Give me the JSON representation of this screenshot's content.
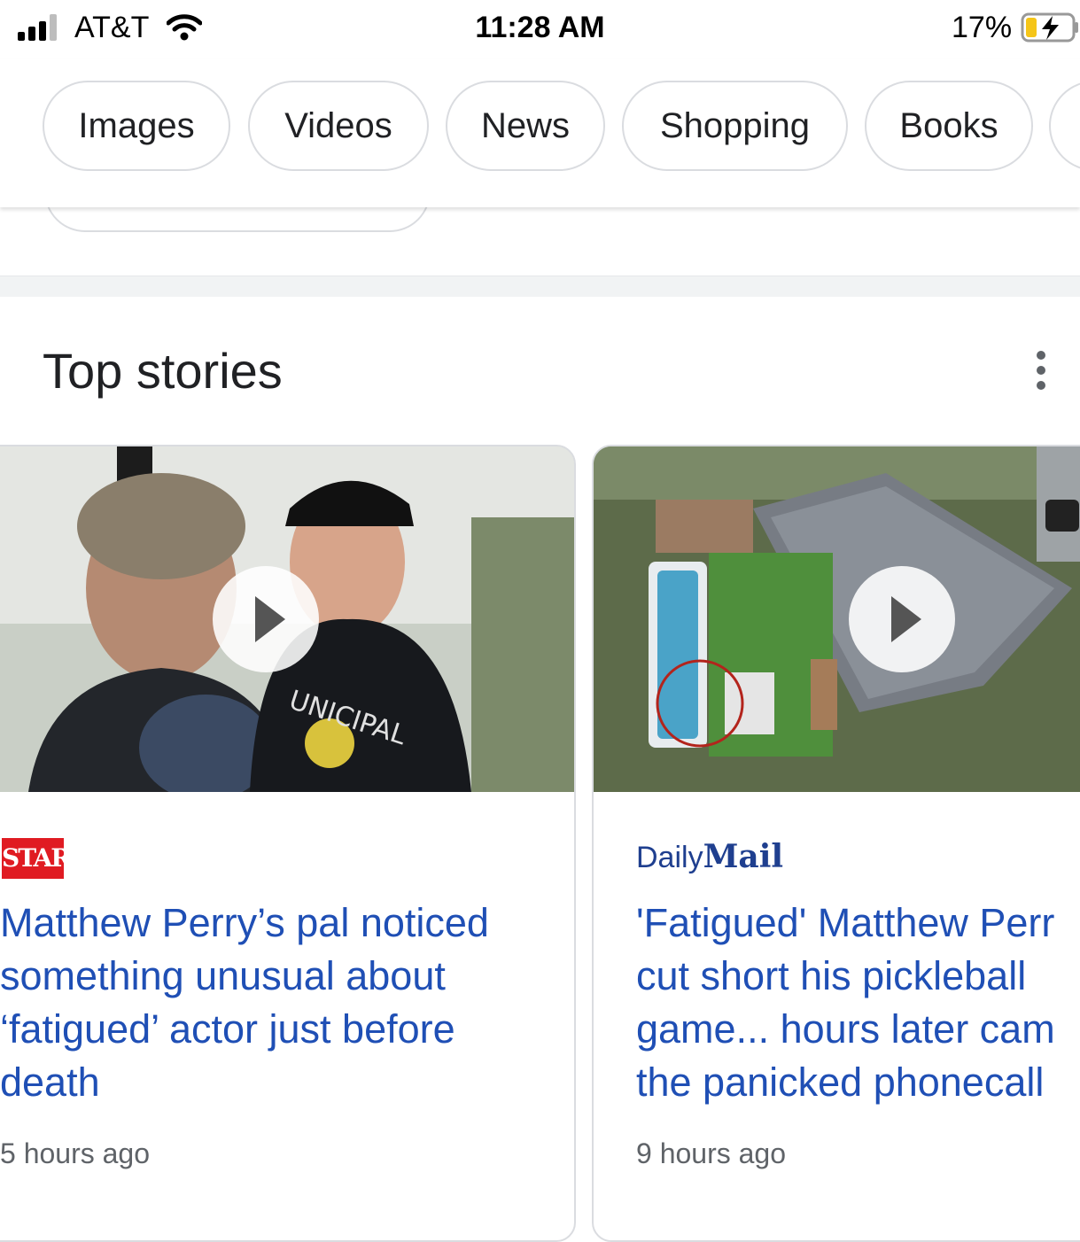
{
  "status_bar": {
    "carrier": "AT&T",
    "time": "11:28 AM",
    "battery": "17%",
    "icons": [
      "signal-icon",
      "wifi-icon",
      "battery-charging-icon"
    ]
  },
  "chips": [
    {
      "label": "Images"
    },
    {
      "label": "Videos"
    },
    {
      "label": "News"
    },
    {
      "label": "Shopping"
    },
    {
      "label": "Books"
    }
  ],
  "top_stories": {
    "title": "Top stories",
    "more_icon": "more-vert-icon",
    "cards": [
      {
        "source": "STAR",
        "headline_lines": [
          "Matthew Perry’s pal noticed",
          "something unusual about",
          "‘fatigued’ actor just before",
          "death"
        ],
        "time": "5 hours ago",
        "has_video": true
      },
      {
        "source_prefix": "Daily",
        "source_main": "Mail",
        "headline_lines": [
          "'Fatigued' Matthew Perr",
          "cut short his pickleball",
          "game... hours later cam",
          "the panicked phonecall"
        ],
        "time": "9 hours ago",
        "has_video": true
      }
    ]
  },
  "colors": {
    "link": "#1f4fb5",
    "chip_border": "#dadce0",
    "star_red": "#e01b22",
    "daily_mail_blue": "#1f3f8f"
  }
}
